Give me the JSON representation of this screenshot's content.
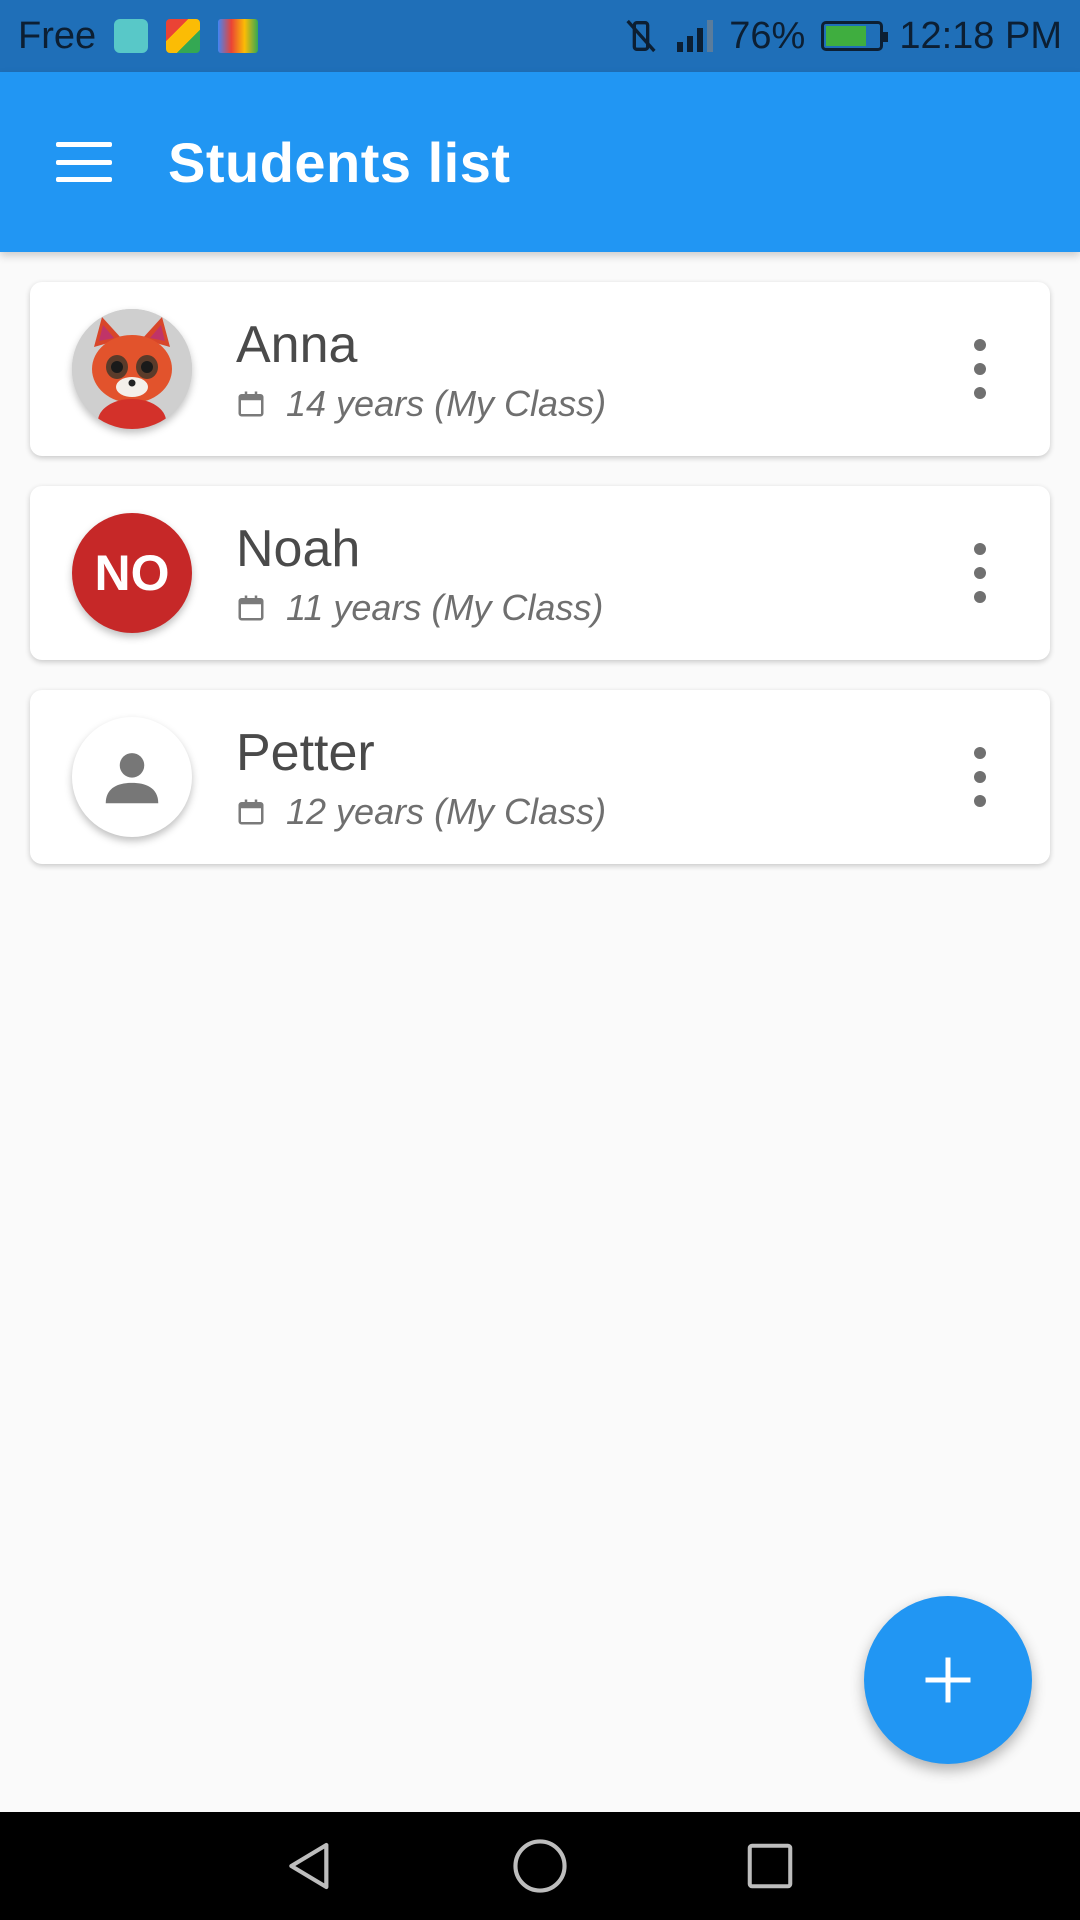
{
  "status_bar": {
    "carrier": "Free",
    "notification_icons": [
      "android-icon",
      "puzzle-icon",
      "gmail-icon"
    ],
    "battery": "76%",
    "battery_level": 0.76,
    "time": "12:18 PM"
  },
  "app_bar": {
    "title": "Students list",
    "color": "#2196f3"
  },
  "students": [
    {
      "name": "Anna",
      "meta": "14 years (My Class)",
      "avatar_type": "photo"
    },
    {
      "name": "Noah",
      "meta": "11 years (My Class)",
      "avatar_type": "initials",
      "initials": "NO",
      "avatar_color": "#c62828"
    },
    {
      "name": "Petter",
      "meta": "12 years (My Class)",
      "avatar_type": "default"
    }
  ],
  "fab": {
    "icon": "plus-icon",
    "color": "#2196f3"
  },
  "nav_bar": {
    "buttons": [
      "back-icon",
      "home-icon",
      "recents-icon"
    ]
  }
}
